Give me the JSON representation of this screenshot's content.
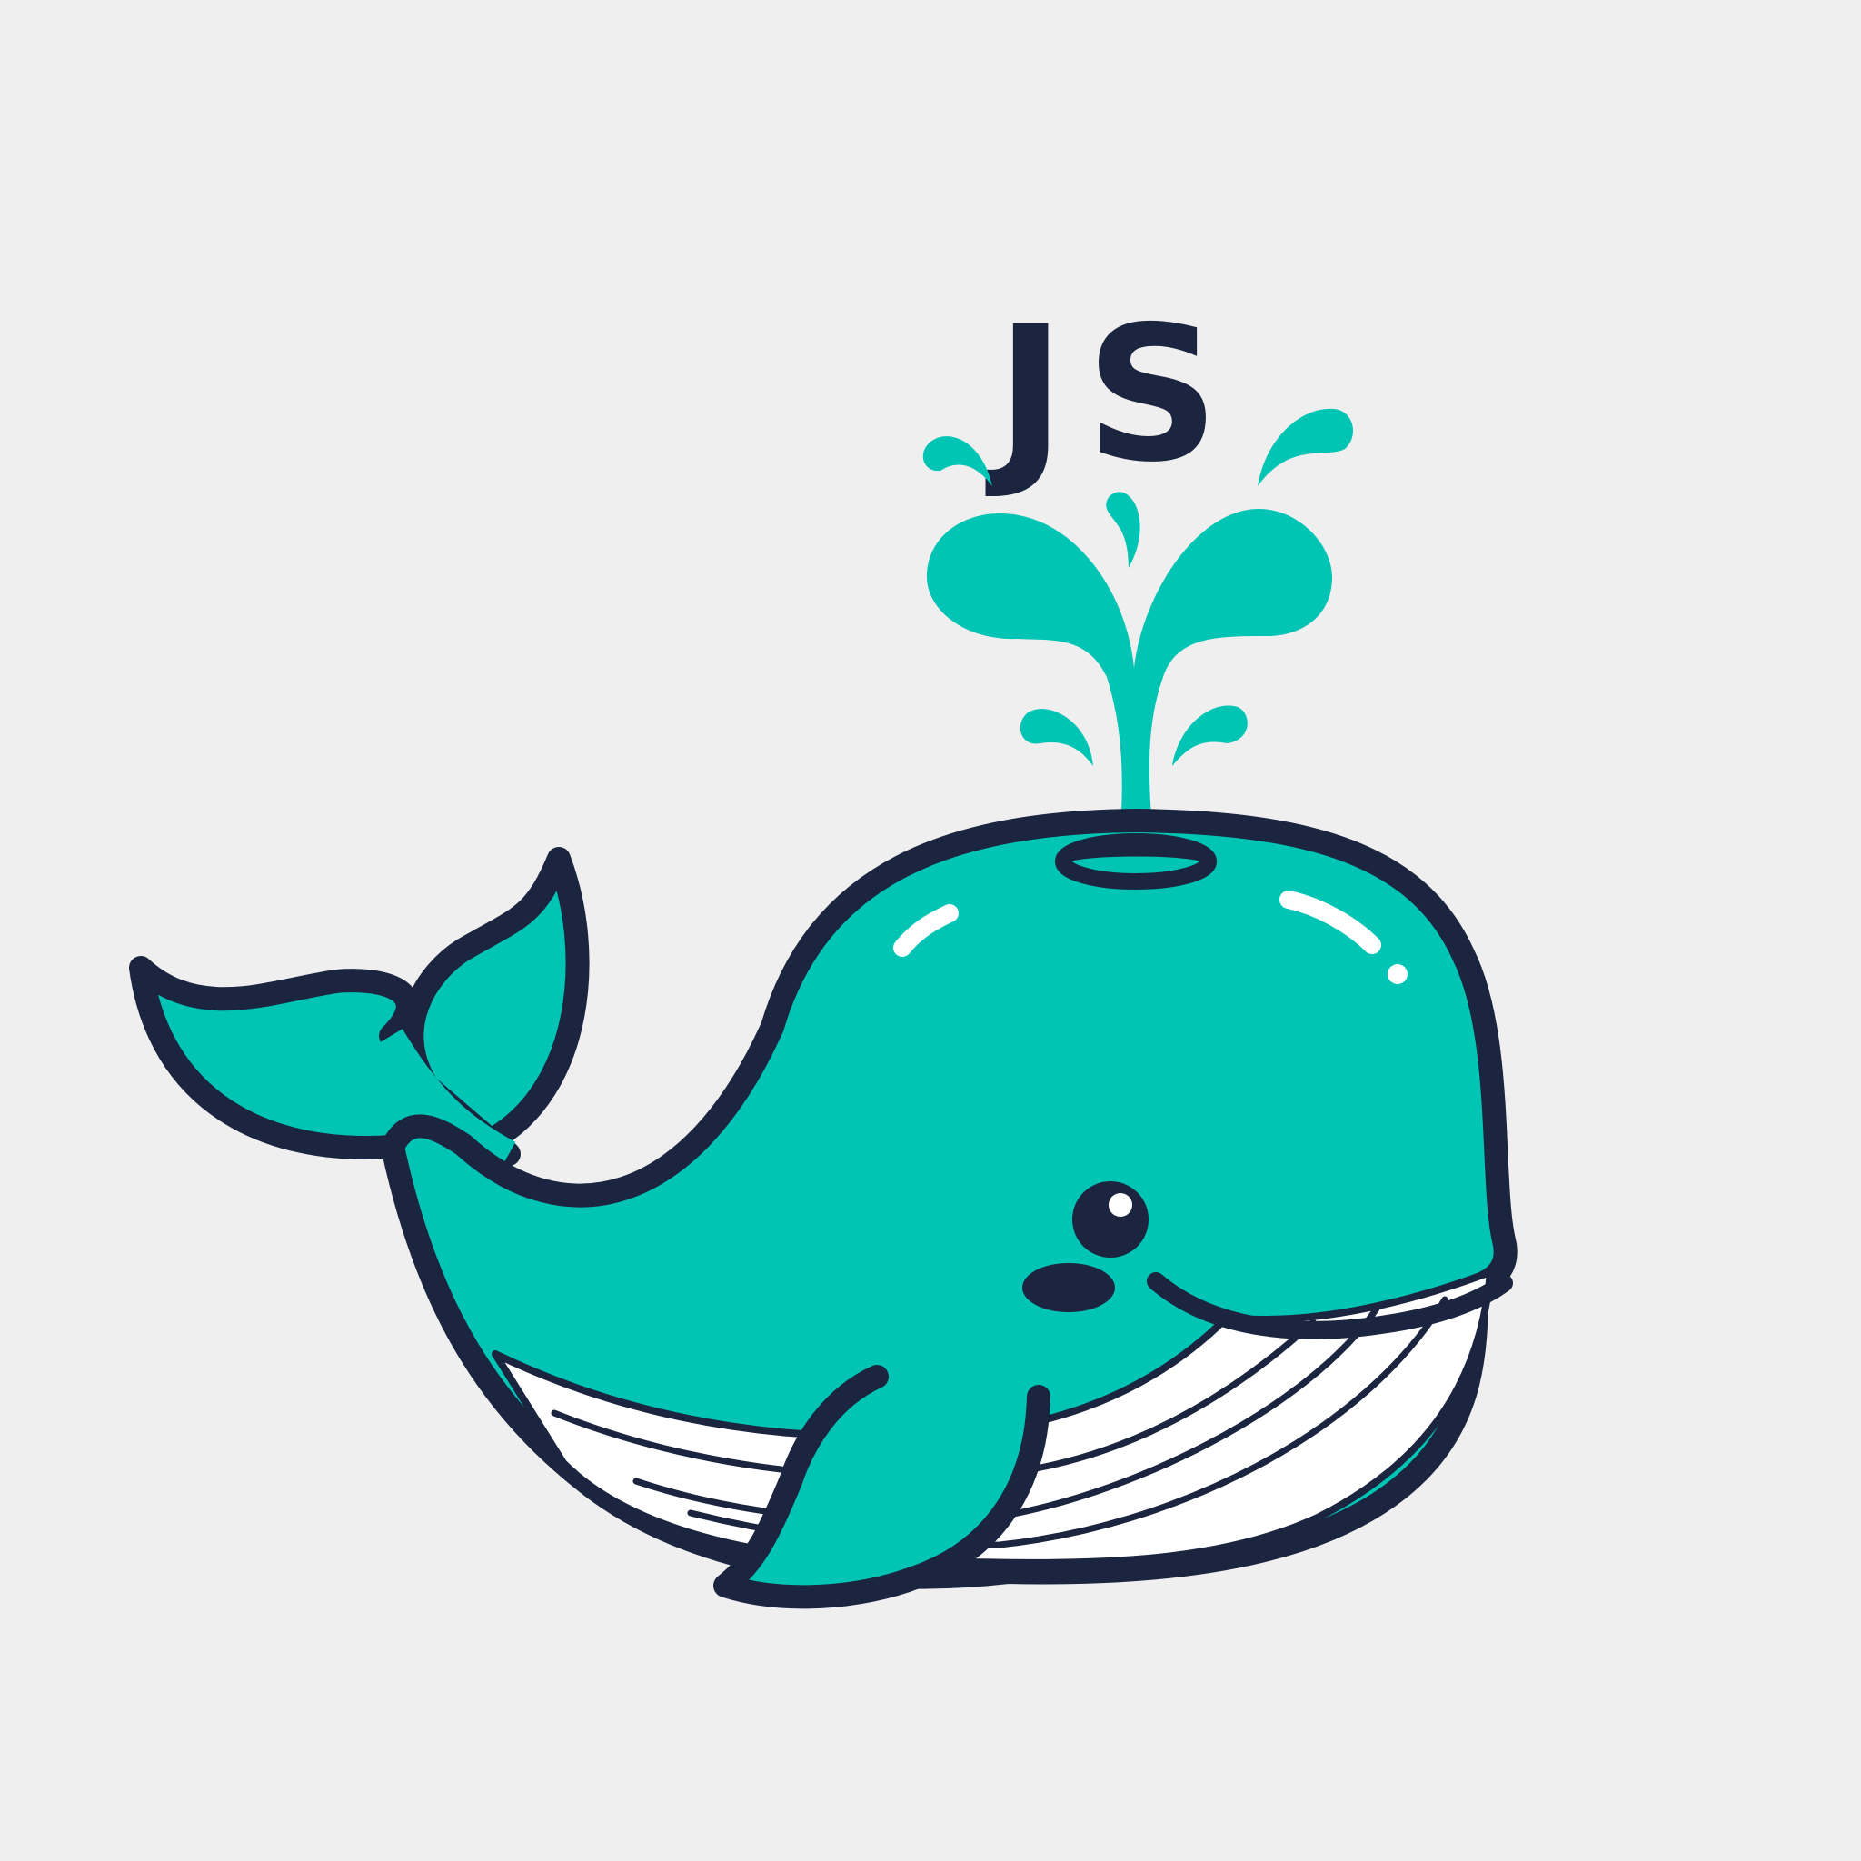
{
  "logo": {
    "text": "JS",
    "colors": {
      "background": "#efefef",
      "body": "#00c4b4",
      "outline": "#1b2540",
      "belly": "#ffffff",
      "highlight": "#ffffff"
    },
    "icons": [
      "whale-icon",
      "water-spout-icon",
      "water-droplet-icon"
    ]
  }
}
